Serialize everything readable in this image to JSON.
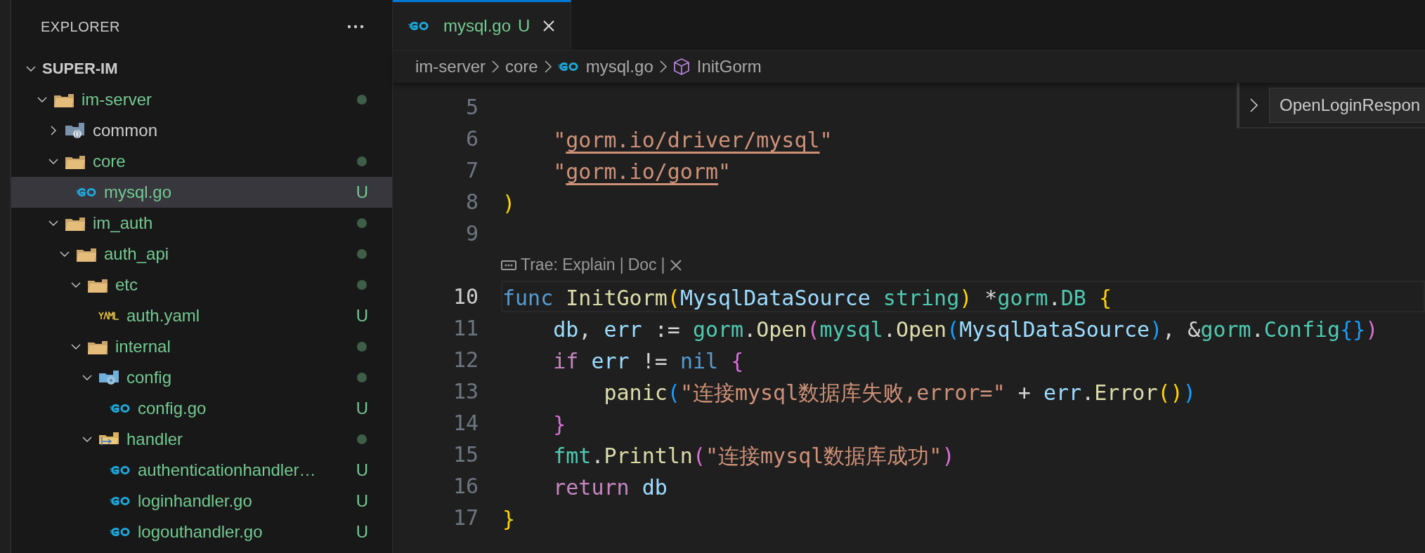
{
  "explorer": {
    "title": "EXPLORER",
    "tree": {
      "name": "SUPER-IM",
      "expanded": true,
      "children": [
        {
          "name": "im-server",
          "kind": "folder",
          "expanded": true,
          "untracked": true,
          "dot": true,
          "selected": false,
          "children": [
            {
              "name": "common",
              "kind": "library",
              "expanded": false,
              "untracked": false,
              "dot": false,
              "selected": false
            },
            {
              "name": "core",
              "kind": "folder",
              "expanded": true,
              "untracked": true,
              "dot": true,
              "selected": false,
              "children": [
                {
                  "name": "mysql.go",
                  "kind": "go",
                  "untracked": true,
                  "badge": "U",
                  "selected": true
                }
              ]
            },
            {
              "name": "im_auth",
              "kind": "folder",
              "expanded": true,
              "untracked": true,
              "dot": true,
              "selected": false,
              "children": [
                {
                  "name": "auth_api",
                  "kind": "folder",
                  "expanded": true,
                  "untracked": true,
                  "dot": true,
                  "selected": false,
                  "children": [
                    {
                      "name": "etc",
                      "kind": "folder",
                      "expanded": true,
                      "untracked": true,
                      "dot": true,
                      "selected": false,
                      "children": [
                        {
                          "name": "auth.yaml",
                          "kind": "yaml",
                          "untracked": true,
                          "badge": "U",
                          "selected": false
                        }
                      ]
                    },
                    {
                      "name": "internal",
                      "kind": "folder",
                      "expanded": true,
                      "untracked": true,
                      "dot": true,
                      "selected": false,
                      "children": [
                        {
                          "name": "config",
                          "kind": "config",
                          "expanded": true,
                          "untracked": true,
                          "dot": true,
                          "selected": false,
                          "children": [
                            {
                              "name": "config.go",
                              "kind": "go",
                              "untracked": true,
                              "badge": "U",
                              "selected": false
                            }
                          ]
                        },
                        {
                          "name": "handler",
                          "kind": "handler",
                          "expanded": true,
                          "untracked": true,
                          "dot": true,
                          "selected": false,
                          "children": [
                            {
                              "name": "authenticationhandler…",
                              "kind": "go",
                              "untracked": true,
                              "badge": "U",
                              "selected": false
                            },
                            {
                              "name": "loginhandler.go",
                              "kind": "go",
                              "untracked": true,
                              "badge": "U",
                              "selected": false
                            },
                            {
                              "name": "logouthandler.go",
                              "kind": "go",
                              "untracked": true,
                              "badge": "U",
                              "selected": false
                            }
                          ]
                        }
                      ]
                    }
                  ]
                }
              ]
            }
          ]
        }
      ]
    }
  },
  "tabs": [
    {
      "label": "mysql.go",
      "kind": "go",
      "badge": "U",
      "selected": true
    }
  ],
  "breadcrumb": [
    {
      "label": "im-server",
      "kind": "folder"
    },
    {
      "label": "core",
      "kind": "folder"
    },
    {
      "label": "mysql.go",
      "kind": "go"
    },
    {
      "label": "InitGorm",
      "kind": "symbol"
    }
  ],
  "sticky": {
    "label": "OpenLoginRespon"
  },
  "lines": [
    {
      "kind": "code",
      "number": "5",
      "current": false
    },
    {
      "kind": "code",
      "number": "6",
      "current": false,
      "tokens": [
        {
          "kind": "str",
          "text": "    \""
        },
        {
          "kind": "link",
          "text": "gorm.io/driver/mysql"
        },
        {
          "kind": "str",
          "text": "\""
        }
      ]
    },
    {
      "kind": "code",
      "number": "7",
      "current": false,
      "tokens": [
        {
          "kind": "str",
          "text": "    \""
        },
        {
          "kind": "link",
          "text": "gorm.io/gorm"
        },
        {
          "kind": "str",
          "text": "\""
        }
      ]
    },
    {
      "kind": "code",
      "number": "8",
      "current": false,
      "tokens": [
        {
          "kind": "b1",
          "text": ")"
        }
      ]
    },
    {
      "kind": "code",
      "number": "9",
      "current": false
    },
    {
      "kind": "codelens",
      "parts": [
        {
          "kind": "link",
          "text": "Trae: Explain"
        },
        {
          "kind": "sep",
          "text": "|"
        },
        {
          "kind": "link",
          "text": "Doc"
        },
        {
          "kind": "sep",
          "text": "|"
        },
        {
          "kind": "close"
        }
      ]
    },
    {
      "kind": "code",
      "number": "10",
      "current": true,
      "tokens": [
        {
          "kind": "kw",
          "text": "func "
        },
        {
          "kind": "fn",
          "text": "InitGorm"
        },
        {
          "kind": "b1",
          "text": "("
        },
        {
          "kind": "var",
          "text": "MysqlDataSource "
        },
        {
          "kind": "type",
          "text": "string"
        },
        {
          "kind": "b1",
          "text": ")"
        },
        {
          "kind": "plain",
          "text": " *"
        },
        {
          "kind": "type",
          "text": "gorm"
        },
        {
          "kind": "plain",
          "text": "."
        },
        {
          "kind": "type",
          "text": "DB "
        },
        {
          "kind": "b1",
          "text": "{"
        }
      ]
    },
    {
      "kind": "code",
      "number": "11",
      "current": false,
      "tokens": [
        {
          "kind": "var",
          "text": "    db"
        },
        {
          "kind": "plain",
          "text": ", "
        },
        {
          "kind": "var",
          "text": "err"
        },
        {
          "kind": "plain",
          "text": " := "
        },
        {
          "kind": "type",
          "text": "gorm"
        },
        {
          "kind": "plain",
          "text": "."
        },
        {
          "kind": "fn",
          "text": "Open"
        },
        {
          "kind": "b2",
          "text": "("
        },
        {
          "kind": "type",
          "text": "mysql"
        },
        {
          "kind": "plain",
          "text": "."
        },
        {
          "kind": "fn",
          "text": "Open"
        },
        {
          "kind": "b3",
          "text": "("
        },
        {
          "kind": "var",
          "text": "MysqlDataSource"
        },
        {
          "kind": "b3",
          "text": ")"
        },
        {
          "kind": "plain",
          "text": ", &"
        },
        {
          "kind": "type",
          "text": "gorm"
        },
        {
          "kind": "plain",
          "text": "."
        },
        {
          "kind": "type",
          "text": "Config"
        },
        {
          "kind": "b3",
          "text": "{}"
        },
        {
          "kind": "b2",
          "text": ")"
        }
      ]
    },
    {
      "kind": "code",
      "number": "12",
      "current": false,
      "tokens": [
        {
          "kind": "ctl",
          "text": "    if "
        },
        {
          "kind": "var",
          "text": "err"
        },
        {
          "kind": "plain",
          "text": " != "
        },
        {
          "kind": "kw",
          "text": "nil "
        },
        {
          "kind": "b2",
          "text": "{"
        }
      ]
    },
    {
      "kind": "code",
      "number": "13",
      "current": false,
      "tokens": [
        {
          "kind": "fn",
          "text": "        panic"
        },
        {
          "kind": "b3",
          "text": "("
        },
        {
          "kind": "str",
          "text": "\"连接mysql数据库失败,error=\""
        },
        {
          "kind": "plain",
          "text": " + "
        },
        {
          "kind": "var",
          "text": "err"
        },
        {
          "kind": "plain",
          "text": "."
        },
        {
          "kind": "fn",
          "text": "Error"
        },
        {
          "kind": "b1",
          "text": "()"
        },
        {
          "kind": "b3",
          "text": ")"
        }
      ]
    },
    {
      "kind": "code",
      "number": "14",
      "current": false,
      "tokens": [
        {
          "kind": "b2",
          "text": "    }"
        }
      ]
    },
    {
      "kind": "code",
      "number": "15",
      "current": false,
      "tokens": [
        {
          "kind": "type",
          "text": "    fmt"
        },
        {
          "kind": "plain",
          "text": "."
        },
        {
          "kind": "fn",
          "text": "Println"
        },
        {
          "kind": "b2",
          "text": "("
        },
        {
          "kind": "str",
          "text": "\"连接mysql数据库成功\""
        },
        {
          "kind": "b2",
          "text": ")"
        }
      ]
    },
    {
      "kind": "code",
      "number": "16",
      "current": false,
      "tokens": [
        {
          "kind": "ctl",
          "text": "    return "
        },
        {
          "kind": "var",
          "text": "db"
        }
      ]
    },
    {
      "kind": "code",
      "number": "17",
      "current": false,
      "tokens": [
        {
          "kind": "b1",
          "text": "}"
        }
      ]
    }
  ]
}
